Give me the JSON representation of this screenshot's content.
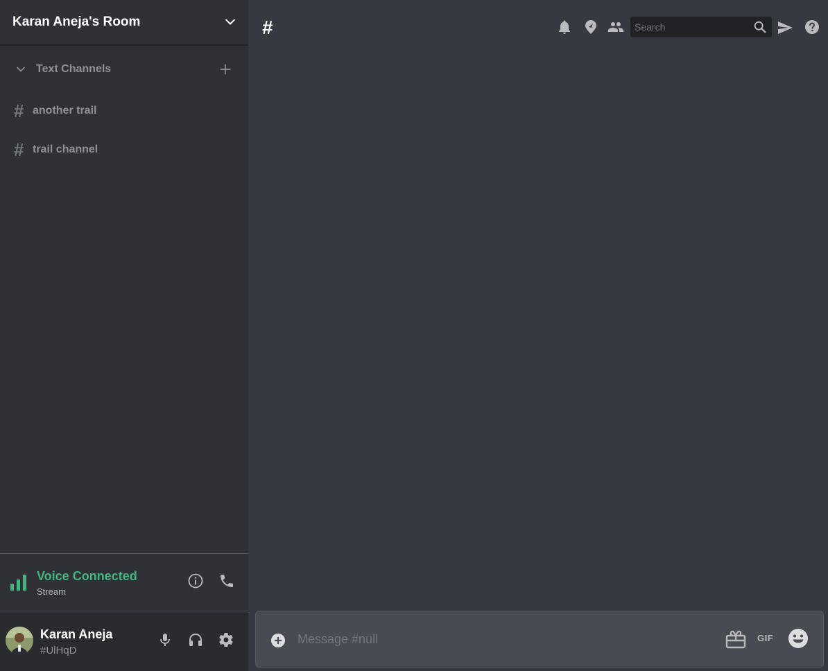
{
  "server": {
    "name": "Karan Aneja's Room"
  },
  "category": {
    "label": "Text Channels"
  },
  "channels": [
    {
      "hash": "#",
      "name": "another trail"
    },
    {
      "hash": "#",
      "name": "trail channel"
    }
  ],
  "voice": {
    "title": "Voice Connected",
    "subtitle": "Stream",
    "color": "#43b581"
  },
  "user": {
    "name": "Karan Aneja",
    "tag": "#UlHqD"
  },
  "topbar": {
    "channel_hash": "#",
    "search_placeholder": "Search",
    "icons": [
      "bell-icon",
      "pin-icon",
      "members-icon",
      "search-icon",
      "send-icon",
      "help-icon"
    ]
  },
  "composer": {
    "placeholder": "Message #null",
    "gif_label": "GIF"
  },
  "theme": {
    "sidebar_bg": "#2f3136",
    "main_bg": "#36393f",
    "user_panel_bg": "#292b2f",
    "accent_green": "#43b581"
  }
}
